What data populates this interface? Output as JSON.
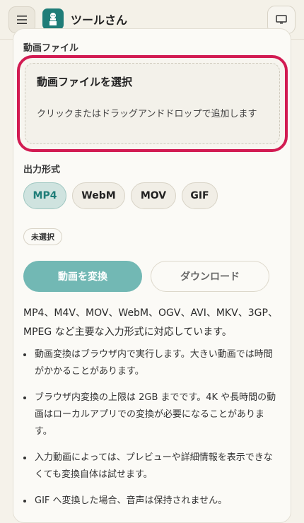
{
  "header": {
    "app_title": "ツールさん",
    "menu_icon": "hamburger-icon",
    "logo_icon": "app-logo-icon",
    "display_icon": "monitor-icon"
  },
  "upload": {
    "section_label": "動画ファイル",
    "title": "動画ファイルを選択",
    "description": "クリックまたはドラッグアンドドロップで追加します"
  },
  "output": {
    "section_label": "出力形式",
    "formats": [
      "MP4",
      "WebM",
      "MOV",
      "GIF"
    ],
    "selected": "MP4",
    "status_badge": "未選択"
  },
  "actions": {
    "convert_label": "動画を変換",
    "download_label": "ダウンロード"
  },
  "info": {
    "supported_formats": "MP4、M4V、MOV、WebM、OGV、AVI、MKV、3GP、MPEG など主要な入力形式に対応しています。",
    "notes": [
      "動画変換はブラウザ内で実行します。大きい動画では時間がかかることがあります。",
      "ブラウザ内変換の上限は 2GB までです。4K や長時間の動画はローカルアプリでの変換が必要になることがあります。",
      "入力動画によっては、プレビューや詳細情報を表示できなくても変換自体は試せます。",
      "GIF へ変換した場合、音声は保持されません。"
    ]
  },
  "colors": {
    "accent": "#1f7d78",
    "highlight_border": "#d21b52",
    "convert_button": "#72b8b4",
    "background": "#f5f2ea"
  }
}
